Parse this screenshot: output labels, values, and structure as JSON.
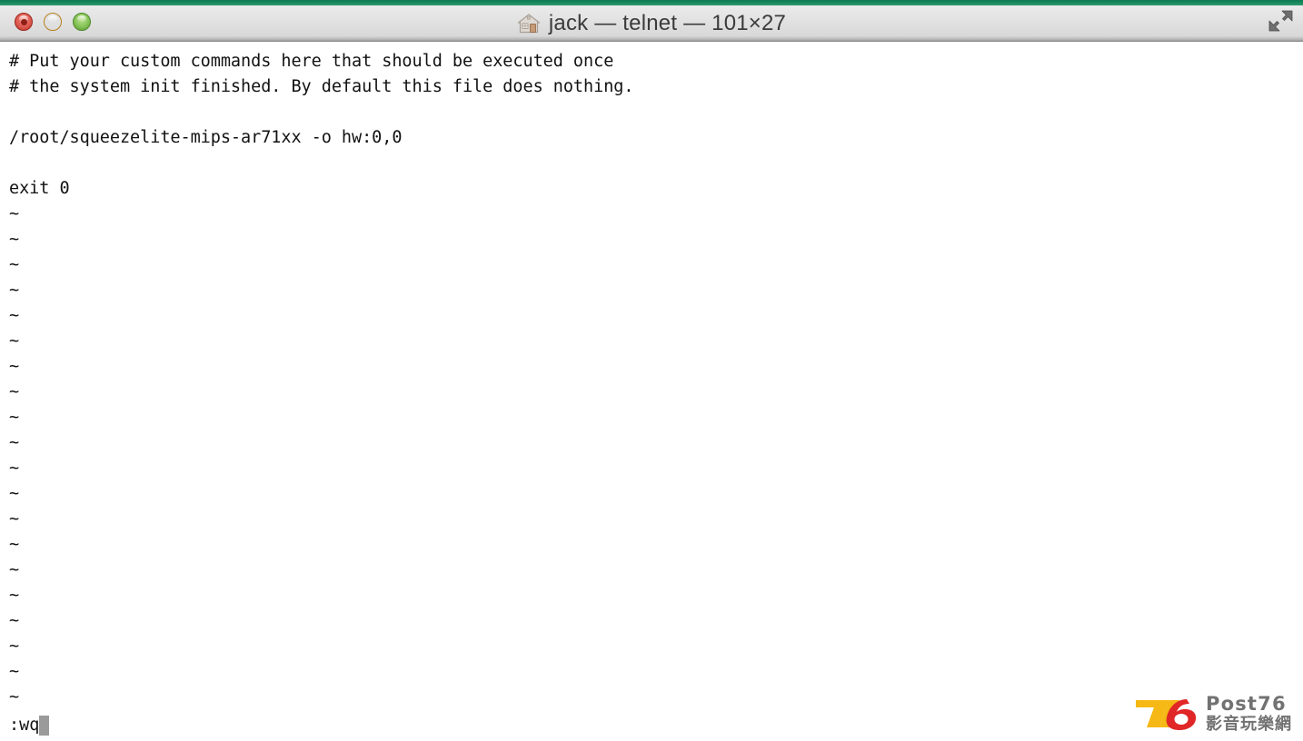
{
  "window": {
    "title": "jack — telnet — 101×27",
    "title_icon": "home-icon",
    "accent_color": "#17875c",
    "titlebar_bg": "#e4e4e4",
    "controls": {
      "close_label": "",
      "minimize_label": "",
      "zoom_label": "",
      "fullscreen_label": ""
    }
  },
  "terminal": {
    "columns": 101,
    "rows": 27,
    "background": "#ffffff",
    "foreground": "#121212",
    "cursor_color": "#9a9a9a",
    "lines": [
      "# Put your custom commands here that should be executed once",
      "# the system init finished. By default this file does nothing.",
      "",
      "/root/squeezelite-mips-ar71xx -o hw:0,0",
      "",
      "exit 0",
      "~",
      "~",
      "~",
      "~",
      "~",
      "~",
      "~",
      "~",
      "~",
      "~",
      "~",
      "~",
      "~",
      "~",
      "~",
      "~",
      "~",
      "~",
      "~",
      "~"
    ],
    "status_line": ":wq",
    "cursor_visible": true
  },
  "watermark": {
    "logo_digits": "76",
    "brand": "Post76",
    "tagline": "影音玩樂網",
    "color_7": "#f5b60d",
    "color_6": "#e02020",
    "text_color": "#6e6e6e"
  }
}
